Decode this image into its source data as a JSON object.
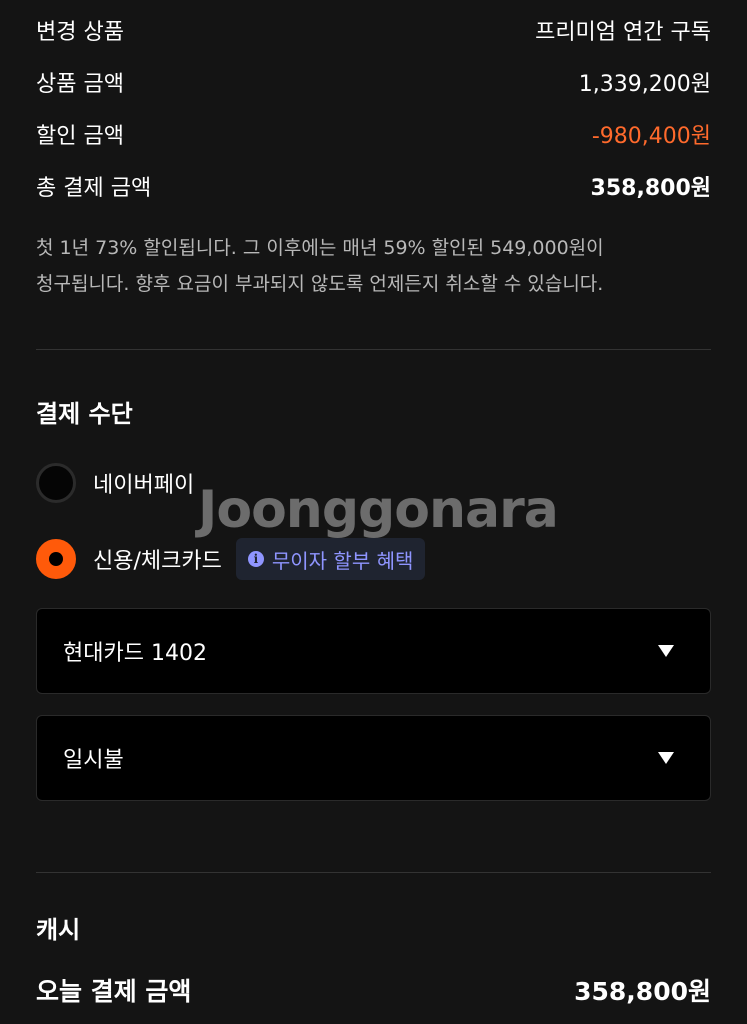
{
  "summary": {
    "product_label": "변경 상품",
    "product_value": "프리미엄 연간 구독",
    "price_label": "상품 금액",
    "price_value": "1,339,200원",
    "discount_label": "할인 금액",
    "discount_value": "-980,400원",
    "total_label": "총 결제 금액",
    "total_value": "358,800원"
  },
  "note": {
    "line1": "첫 1년 73% 할인됩니다. 그 이후에는 매년 59% 할인된 549,000원이",
    "line2": "청구됩니다. 향후 요금이 부과되지 않도록 언제든지 취소할 수 있습니다."
  },
  "payment": {
    "title": "결제 수단",
    "options": [
      {
        "label": "네이버페이",
        "selected": false
      },
      {
        "label": "신용/체크카드",
        "selected": true
      }
    ],
    "badge": {
      "icon": "info-icon",
      "label": "무이자 할부 혜택"
    },
    "card_select": "현대카드 1402",
    "installment_select": "일시불"
  },
  "watermark": "Joonggonara",
  "cash": {
    "title": "캐시",
    "today_label": "오늘 결제 금액",
    "today_value": "358,800원"
  },
  "colors": {
    "accent": "#ff5a0a",
    "discount": "#ff6a2c",
    "badge_text": "#8f95ff",
    "background": "#141414"
  }
}
